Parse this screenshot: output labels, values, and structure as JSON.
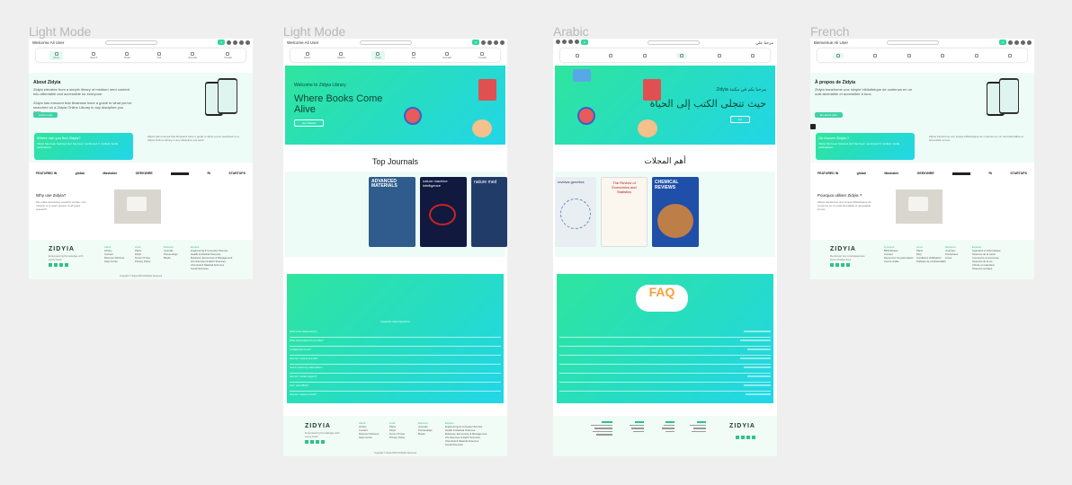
{
  "columns": [
    {
      "label": "Light Mode"
    },
    {
      "label": "Light Mode"
    },
    {
      "label": "Arabic"
    },
    {
      "label": "French"
    }
  ],
  "colors": {
    "accent": "#34d7a0",
    "gradient_start": "#2fe59d",
    "gradient_end": "#22d6e8",
    "mint_bg": "#eefcf7"
  },
  "en_about": {
    "welcome": "Welcome Ali User",
    "nav": [
      "Home",
      "Search",
      "Read",
      "Ask",
      "Journals",
      "Contact"
    ],
    "about_title": "About Zidyia",
    "about_body": "Zidyia elevates from a simple library of medium nerd content into affordable and accessible for everyone.",
    "about_body2": "Zidyia has ensured that librarians have a guide to what you've searched on a Zidyia Online Library in any discipline you want.",
    "learn_more": "Learn more",
    "where_title": "Where can you find Zidyia?",
    "where_body": "Zidyia has been featured and has been mentioned in multiple media publications.",
    "logos": [
      "FEATURED IN",
      "global",
      "Mashable",
      "GEEKWIRE",
      "",
      "Ri",
      "STARTUPS"
    ],
    "why_title": "Why use Zidyia?",
    "why_body": "We make accessing research simple. Our mission is to open access to all good research.",
    "footer_tagline": "Empowering Knowledge with every book",
    "footer_cols": [
      {
        "title": "About",
        "items": [
          "Library",
          "Contact",
          "Discover Partners",
          "Help Center"
        ]
      },
      {
        "title": "Links",
        "items": [
          "Plans",
          "FAQs",
          "Terms Of Use",
          "Privacy Policy"
        ]
      },
      {
        "title": "Discover",
        "items": [
          "Journals",
          "Proceedings",
          "Books"
        ]
      },
      {
        "title": "Explore",
        "items": [
          "Engineering & Computer Science",
          "Health & Medical Sciences",
          "Business, Economics & Management",
          "Life Sciences & Earth Sciences",
          "Chemical & Material Sciences",
          "Social Sciences"
        ]
      }
    ],
    "copyright": "Copyright © Zidyia 2023 All Rights Reserved"
  },
  "en_home": {
    "welcome": "Welcome Ali User",
    "hero_kicker": "Welcome to Zidyia Library",
    "hero_title": "Where Books Come Alive",
    "hero_button": "Get Started",
    "journals_title": "Top Journals",
    "journals": [
      "ADVANCED MATERIALS",
      "nature machine intelligence",
      "nature med"
    ],
    "faq_caption": "Frequently Asked Questions",
    "faq_items": [
      "What is the Zidyia Library?",
      "What subscriptions do you offer?",
      "Is Zidyia free to use?",
      "How can I access journals?",
      "How to cancel my subscription?",
      "How do I contact support?",
      "Can I read offline?",
      "How do I request a book?"
    ]
  },
  "ar_home": {
    "welcome": "مرحبا علي",
    "hero_kicker": "مرحبا بكم في مكتبة Zidyia",
    "hero_title": "حيث تتجلى الكتب إلى الحياة",
    "hero_button": "ابدأ",
    "journals_title": "أهم المجلات",
    "journals": [
      "reviews genetics",
      "The Review of Economics and Statistics",
      "CHEMICAL REVIEWS"
    ],
    "faq_logo": "FAQ"
  },
  "fr_about": {
    "welcome": "Bienvenue Ali User",
    "about_title": "À propos de Zidyia",
    "about_body": "Zidyia transforme une simple bibliothèque de contenus en un outil abordable et accessible à tous.",
    "learn_more": "En savoir plus",
    "where_title": "Où trouver Zidyia ?",
    "why_title": "Pourquoi utiliser Zidyia ?",
    "footer_tagline": "Renforcer les connaissances avec chaque livre",
    "footer_cols": [
      {
        "title": "À propos",
        "items": [
          "Bibliothèque",
          "Contact",
          "Découvrez les partenaires",
          "Centre d'aide"
        ]
      },
      {
        "title": "Liens",
        "items": [
          "Plans",
          "FAQ",
          "Conditions d'utilisation",
          "Politique de confidentialité"
        ]
      },
      {
        "title": "Découvrir",
        "items": [
          "Journaux",
          "Procédures",
          "Livres"
        ]
      },
      {
        "title": "Explorer",
        "items": [
          "Ingénierie et informatique",
          "Sciences de la santé",
          "Commerce et économie",
          "Sciences de la vie",
          "Chimie et matériaux",
          "Sciences sociales"
        ]
      }
    ]
  },
  "brand": "ZIDYIA"
}
